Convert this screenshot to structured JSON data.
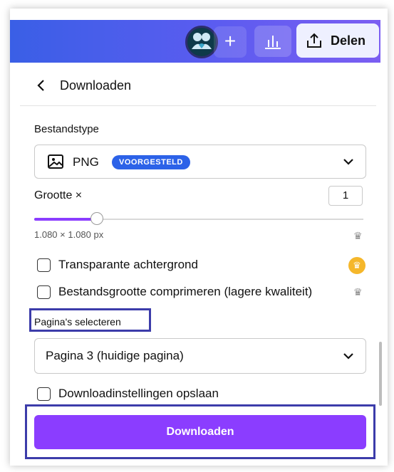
{
  "header": {
    "share_label": "Delen",
    "plus_label": "+"
  },
  "panel": {
    "title": "Downloaden",
    "file_type": {
      "section_label": "Bestandstype",
      "selected_value": "PNG",
      "badge": "VOORGESTELD"
    },
    "size": {
      "label": "Grootte ×",
      "multiplier": "1",
      "slider_level": 0.19,
      "dimensions": "1.080 × 1.080 px"
    },
    "options": [
      {
        "label": "Transparante achtergrond",
        "checked": false
      },
      {
        "label": "Bestandsgrootte comprimeren (lagere kwaliteit)",
        "checked": false
      }
    ],
    "pages": {
      "section_label": "Pagina's selecteren",
      "selected_value": "Pagina 3 (huidige pagina)"
    },
    "save_settings_label": "Downloadinstellingen opslaan",
    "download_button_label": "Downloaden"
  },
  "colors": {
    "accent": "#8b3dff",
    "badge": "#2c62e8",
    "premium": "#f5b72b",
    "highlight": "#3c3caa"
  }
}
